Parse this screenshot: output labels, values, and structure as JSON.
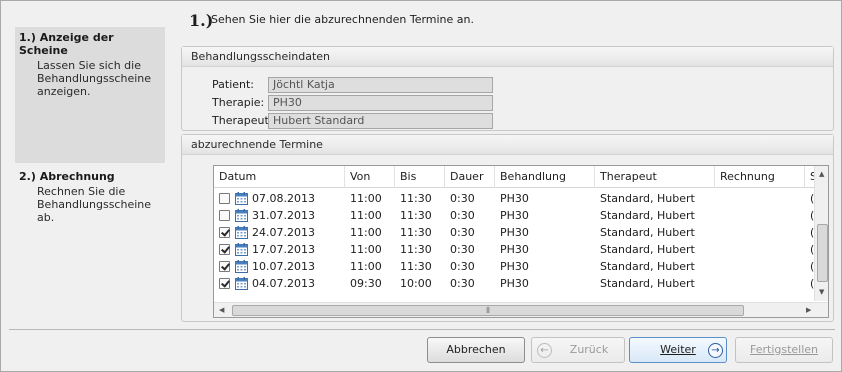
{
  "steps": [
    {
      "title": "1.) Anzeige der Scheine",
      "desc": "Lassen Sie sich die Behandlungsscheine anzeigen."
    },
    {
      "title": "2.) Abrechnung",
      "desc": "Rechnen Sie die Behandlungsscheine ab."
    }
  ],
  "header": {
    "num": "1.)",
    "text": "Sehen Sie hier die abzurechnenden Termine an."
  },
  "schein": {
    "title": "Behandlungsscheindaten",
    "patient_label": "Patient:",
    "patient_value": "Jöchtl Katja",
    "therapie_label": "Therapie:",
    "therapie_value": "PH30",
    "therapeut_label": "Therapeut:",
    "therapeut_value": "Hubert Standard"
  },
  "termine": {
    "title": "abzurechnende Termine",
    "columns": [
      "Datum",
      "Von",
      "Bis",
      "Dauer",
      "Behandlung",
      "Therapeut",
      "Rechnung",
      "S"
    ],
    "rows": [
      {
        "checked": false,
        "datum": "07.08.2013",
        "von": "11:00",
        "bis": "11:30",
        "dauer": "0:30",
        "behandlung": "PH30",
        "therapeut": "Standard, Hubert",
        "rechnung": "",
        "s": "("
      },
      {
        "checked": false,
        "datum": "31.07.2013",
        "von": "11:00",
        "bis": "11:30",
        "dauer": "0:30",
        "behandlung": "PH30",
        "therapeut": "Standard, Hubert",
        "rechnung": "",
        "s": "("
      },
      {
        "checked": true,
        "datum": "24.07.2013",
        "von": "11:00",
        "bis": "11:30",
        "dauer": "0:30",
        "behandlung": "PH30",
        "therapeut": "Standard, Hubert",
        "rechnung": "",
        "s": "("
      },
      {
        "checked": true,
        "datum": "17.07.2013",
        "von": "11:00",
        "bis": "11:30",
        "dauer": "0:30",
        "behandlung": "PH30",
        "therapeut": "Standard, Hubert",
        "rechnung": "",
        "s": "("
      },
      {
        "checked": true,
        "datum": "10.07.2013",
        "von": "11:00",
        "bis": "11:30",
        "dauer": "0:30",
        "behandlung": "PH30",
        "therapeut": "Standard, Hubert",
        "rechnung": "",
        "s": "("
      },
      {
        "checked": true,
        "datum": "04.07.2013",
        "von": "09:30",
        "bis": "10:00",
        "dauer": "0:30",
        "behandlung": "PH30",
        "therapeut": "Standard, Hubert",
        "rechnung": "",
        "s": "("
      }
    ]
  },
  "buttons": {
    "abbrechen": "Abbrechen",
    "zurueck": "Zurück",
    "weiter": "Weiter",
    "fertigstellen": "Fertigstellen"
  },
  "icons": {
    "calendar": "calendar-icon",
    "back": "arrow-left-circle-icon",
    "next": "arrow-right-circle-icon"
  },
  "colors": {
    "accent": "#3a78c2",
    "nav_active_bg": "#dcdcdc"
  }
}
